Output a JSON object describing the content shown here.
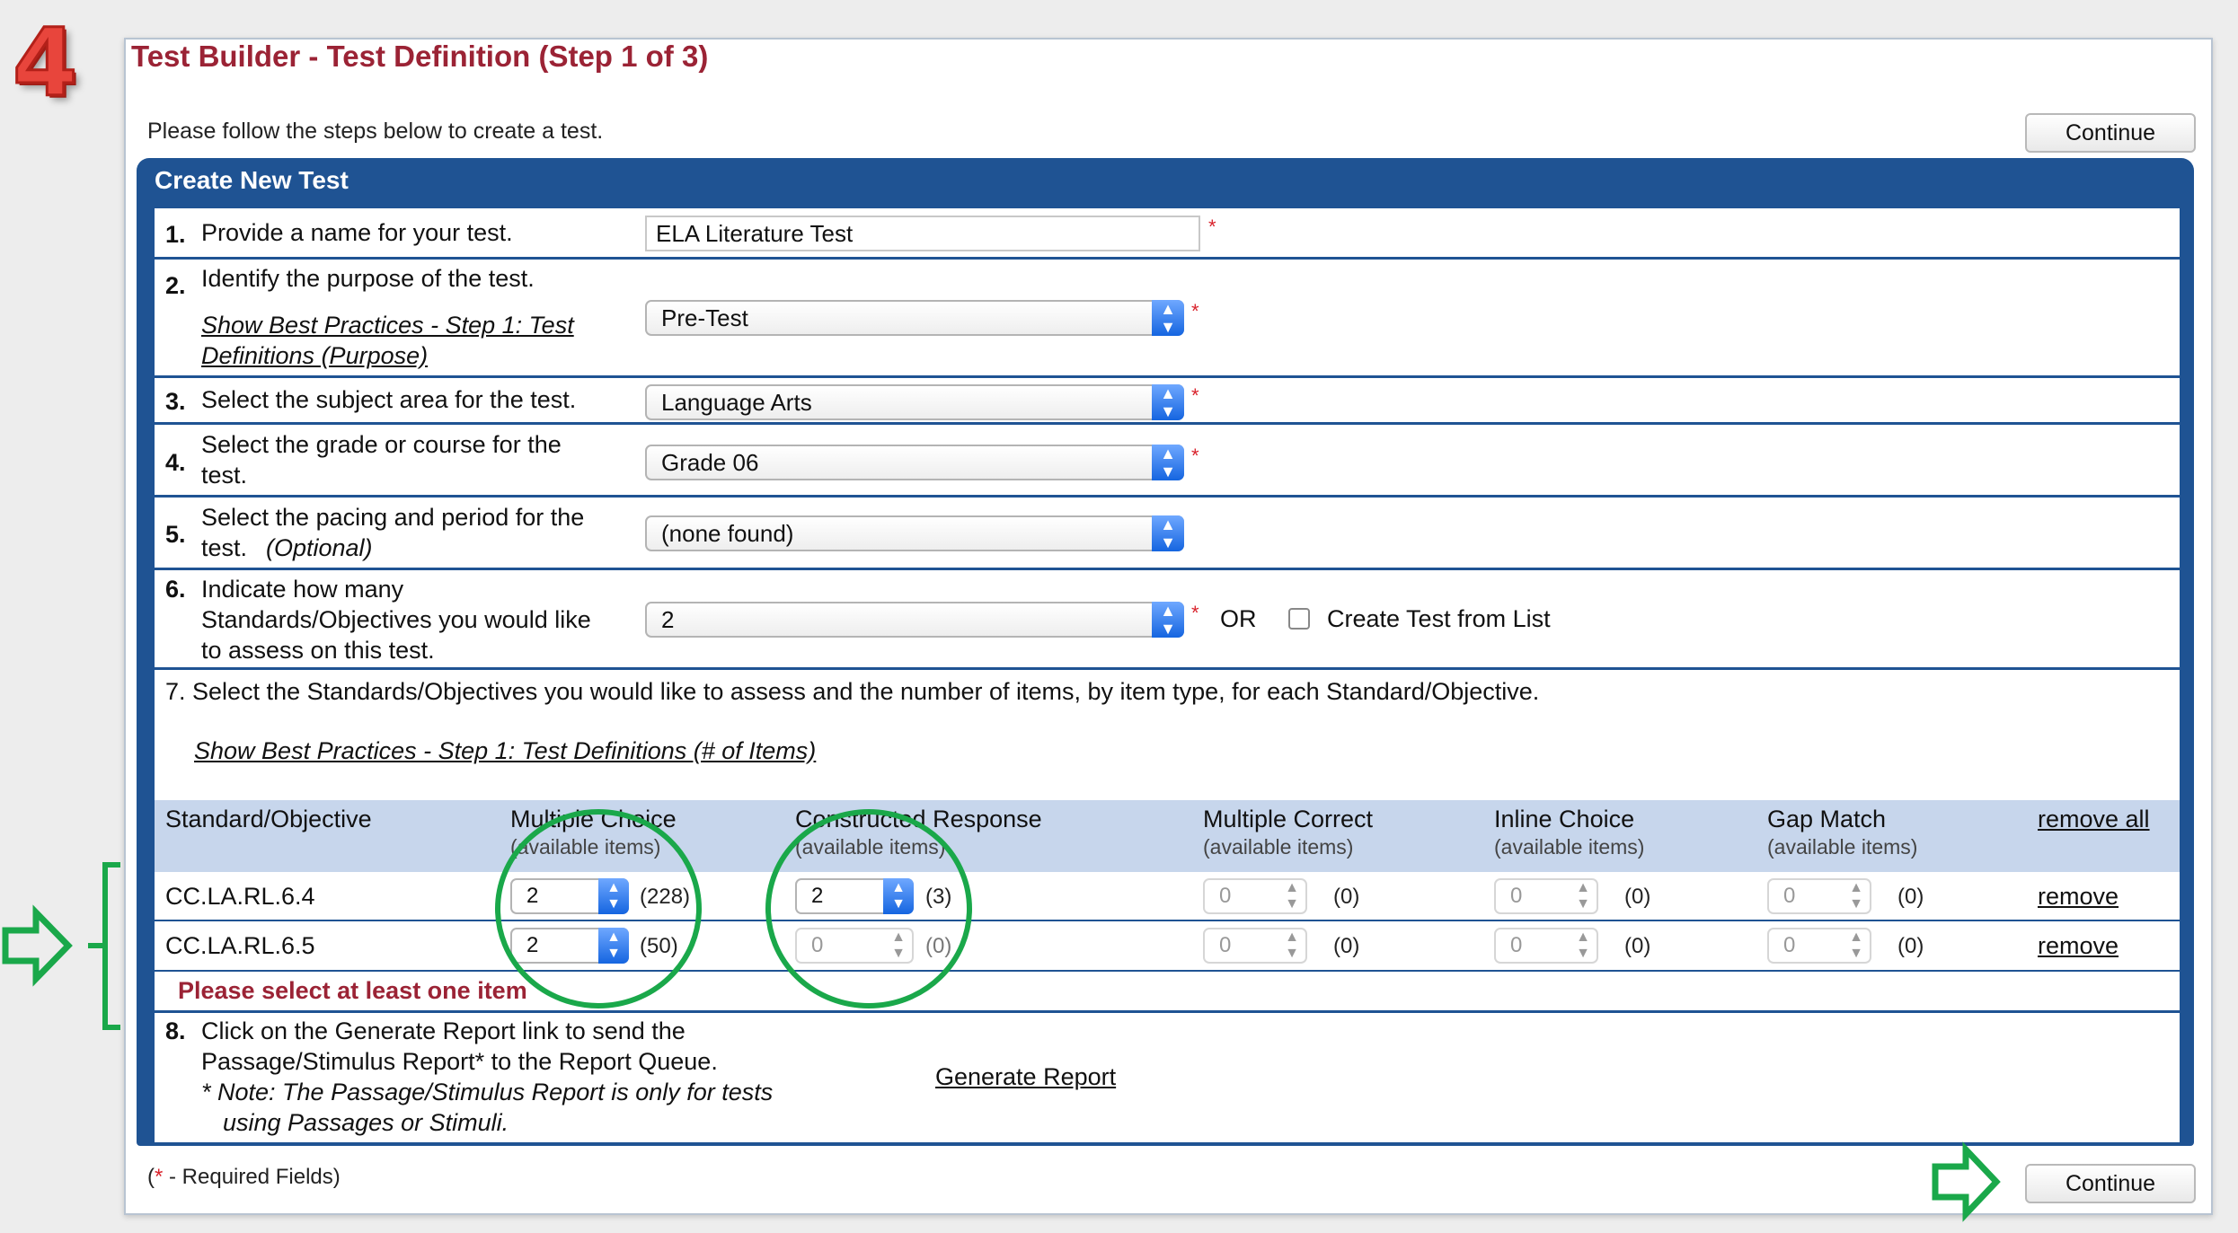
{
  "step_badge": "4",
  "page_title": "Test Builder - Test Definition (Step 1 of 3)",
  "intro": "Please follow the steps below to create a test.",
  "continue_label": "Continue",
  "box_title": "Create New Test",
  "required_mark": "*",
  "steps": {
    "s1": {
      "num": "1.",
      "label": "Provide a name for your test.",
      "value": "ELA Literature Test"
    },
    "s2": {
      "num": "2.",
      "label": "Identify the purpose of the test.",
      "link_line1": "Show Best Practices - Step 1: Test",
      "link_line2": "Definitions (Purpose)",
      "value": "Pre-Test"
    },
    "s3": {
      "num": "3.",
      "label": "Select the subject area for the test.",
      "value": "Language Arts"
    },
    "s4": {
      "num": "4.",
      "label_line1": "Select the grade or course for the",
      "label_line2": "test.",
      "value": "Grade 06"
    },
    "s5": {
      "num": "5.",
      "label_line1": "Select the pacing and period for the",
      "label_line2": "test.",
      "optional": "(Optional)",
      "value": "(none found)"
    },
    "s6": {
      "num": "6.",
      "label_line1": "Indicate how many",
      "label_line2": "Standards/Objectives you would like",
      "label_line3": "to assess on this test.",
      "value": "2",
      "or": "OR",
      "checkbox_label": "Create Test from List"
    },
    "s7": {
      "label": "7. Select the Standards/Objectives you would like to assess and the number of items, by item type, for each Standard/Objective.",
      "link": "Show Best Practices - Step 1: Test Definitions (# of Items)"
    },
    "s8": {
      "num": "8.",
      "line1": "Click on the Generate Report link to send the",
      "line2": "Passage/Stimulus Report* to the Report Queue.",
      "note1": "* Note: The Passage/Stimulus Report is only for tests",
      "note2": "using Passages or Stimuli.",
      "link": "Generate Report"
    }
  },
  "table": {
    "headers": {
      "standard": "Standard/Objective",
      "mc": "Multiple Choice",
      "cr": "Constructed Response",
      "mcorrect": "Multiple Correct",
      "inline": "Inline Choice",
      "gap": "Gap Match",
      "sub": "(available items)",
      "remove_all": "remove all"
    },
    "rows": [
      {
        "standard": "CC.LA.RL.6.4",
        "mc": "2",
        "mc_avail": "(228)",
        "cr": "2",
        "cr_avail": "(3)",
        "mcorrect": "0",
        "mcorrect_avail": "(0)",
        "inline": "0",
        "inline_avail": "(0)",
        "gap": "0",
        "gap_avail": "(0)",
        "remove": "remove"
      },
      {
        "standard": "CC.LA.RL.6.5",
        "mc": "2",
        "mc_avail": "(50)",
        "cr": "0",
        "cr_avail": "(0)",
        "mcorrect": "0",
        "mcorrect_avail": "(0)",
        "inline": "0",
        "inline_avail": "(0)",
        "gap": "0",
        "gap_avail": "(0)",
        "remove": "remove"
      }
    ]
  },
  "warning": "Please select at least one item",
  "required_note": "- Required Fields)",
  "required_note_open": "(",
  "annotation_color": "#1aa84a",
  "accent_color": "#1f5393"
}
